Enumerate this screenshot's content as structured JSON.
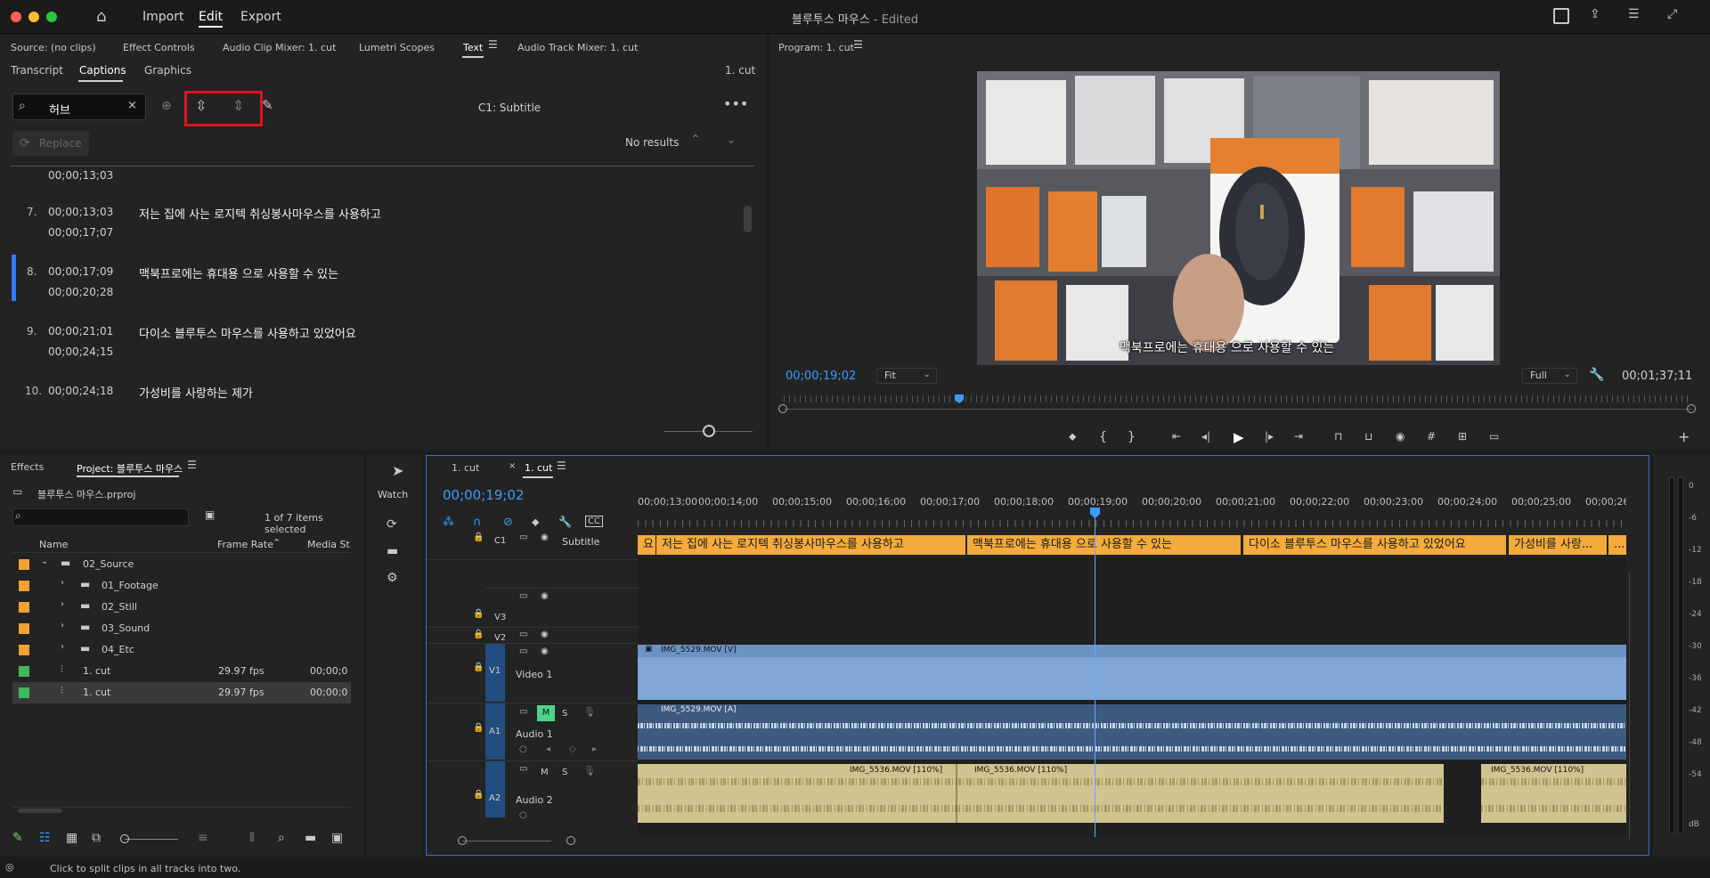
{
  "window": {
    "title": "블루투스 마우스",
    "title_suffix": " - Edited"
  },
  "menu": {
    "import": "Import",
    "edit": "Edit",
    "export": "Export"
  },
  "source_tabs": [
    "Source: (no clips)",
    "Effect Controls",
    "Audio Clip Mixer: 1. cut",
    "Lumetri Scopes",
    "Text",
    "Audio Track Mixer: 1. cut"
  ],
  "text_subtabs": [
    "Transcript",
    "Captions",
    "Graphics"
  ],
  "text_seq": "1. cut",
  "search": {
    "value": "허브",
    "track": "C1: Subtitle",
    "replace_label": "Replace",
    "results": "No results"
  },
  "captions": [
    {
      "num": "",
      "start": "",
      "end": "00;00;13;03",
      "text": ""
    },
    {
      "num": "7.",
      "start": "00;00;13;03",
      "end": "00;00;17;07",
      "text": "저는 집에 사는 로지텍 취싱봉사마우스를 사용하고"
    },
    {
      "num": "8.",
      "start": "00;00;17;09",
      "end": "00;00;20;28",
      "text": "맥북프로에는 휴대용 으로 사용할 수 있는"
    },
    {
      "num": "9.",
      "start": "00;00;21;01",
      "end": "00;00;24;15",
      "text": "다이소 블루투스 마우스를 사용하고 있었어요"
    },
    {
      "num": "10.",
      "start": "00;00;24;18",
      "end": "",
      "text": "가성비를 사랑하는 제가"
    }
  ],
  "program": {
    "title": "Program: 1. cut",
    "timecode": "00;00;19;02",
    "fit": "Fit",
    "quality": "Full",
    "duration": "00;01;37;11",
    "subtitle": "맥북프로에는 휴대용 으로 사용할 수 있는"
  },
  "project": {
    "effects_tab": "Effects",
    "tab": "Project: 블루투스 마우스",
    "file": "블루투스 마우스.prproj",
    "count": "1 of 7 items selected",
    "col_name": "Name",
    "col_fps": "Frame Rate",
    "col_media": "Media Sta",
    "rows": [
      {
        "name": "02_Source",
        "fps": "",
        "media": "",
        "color": "#f0a234"
      },
      {
        "name": "01_Footage",
        "fps": "",
        "media": "",
        "color": "#f0a234"
      },
      {
        "name": "02_Still",
        "fps": "",
        "media": "",
        "color": "#f0a234"
      },
      {
        "name": "03_Sound",
        "fps": "",
        "media": "",
        "color": "#f0a234"
      },
      {
        "name": "04_Etc",
        "fps": "",
        "media": "",
        "color": "#f0a234"
      },
      {
        "name": "1. cut",
        "fps": "29.97 fps",
        "media": "00;00;0",
        "color": "#3fb85a"
      },
      {
        "name": "1. cut",
        "fps": "29.97 fps",
        "media": "00;00;0",
        "color": "#3fb85a"
      }
    ]
  },
  "tools": {
    "watch": "Watch"
  },
  "timeline": {
    "tab1": "1. cut",
    "tab2": "1. cut",
    "timecode": "00;00;19;02",
    "ruler": [
      "00;00;13;00",
      "00;00;14;00",
      "00;00;15;00",
      "00;00;16;00",
      "00;00;17;00",
      "00;00;18;00",
      "00;00;19;00",
      "00;00;20;00",
      "00;00;21;00",
      "00;00;22;00",
      "00;00;23;00",
      "00;00;24;00",
      "00;00;25;00",
      "00;00;26;00"
    ],
    "c1": "C1",
    "subtitle": "Subtitle",
    "v3": "V3",
    "v2": "V2",
    "v1": "V1",
    "video1": "Video 1",
    "a1": "A1",
    "audio1": "Audio 1",
    "a2": "Audio 2",
    "a2s": "A2",
    "m": "M",
    "s": "S",
    "caption_blocks": [
      "요",
      "저는 집에 사는 로지텍 취싱봉사마우스를 사용하고",
      "맥북프로에는 휴대용 으로 사용할 수 있는",
      "다이소 블루투스 마우스를 사용하고 있었어요",
      "가성비를 사랑...",
      "..."
    ],
    "v1_clip": "IMG_5529.MOV [V]",
    "a1_clip": "IMG_5529.MOV [A]",
    "a2_clips": [
      "IMG_5536.MOV [110%]",
      "IMG_5536.MOV [110%]",
      "IMG_5536.MOV [110%]"
    ]
  },
  "meter": [
    "0",
    "-6",
    "-12",
    "-18",
    "-24",
    "-30",
    "-36",
    "-42",
    "-48",
    "-54",
    "dB"
  ],
  "status": "Click to split clips in all tracks into two."
}
